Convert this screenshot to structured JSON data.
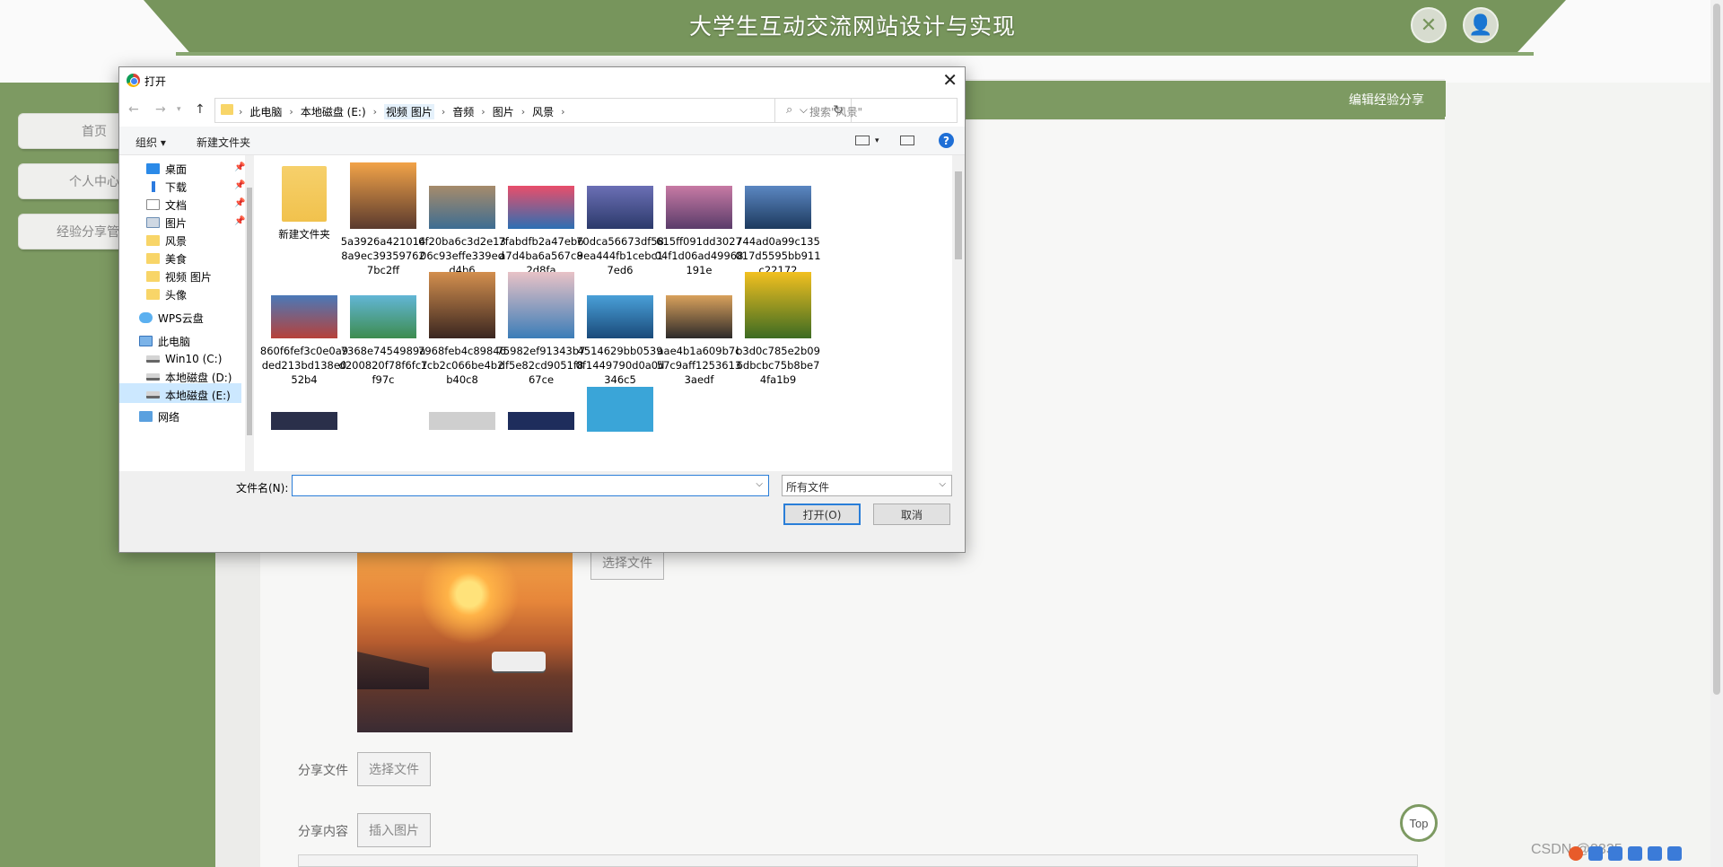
{
  "site": {
    "title": "大学生互动交流网站设计与实现",
    "green_bar_text": "编辑经验分享",
    "side_menu": [
      "首页",
      "个人中心",
      "经验分享管理"
    ],
    "choose_file_label": "选择文件",
    "share_file_label": "分享文件",
    "share_content_label": "分享内容",
    "insert_image_label": "插入图片",
    "top_button": "Top",
    "watermark": "CSDN @3335"
  },
  "dialog": {
    "title": "打开",
    "breadcrumbs": [
      "此电脑",
      "本地磁盘 (E:)",
      "视频 图片",
      "音频",
      "图片",
      "风景"
    ],
    "search_placeholder": "搜索\"风景\"",
    "organize": "组织 ▾",
    "new_folder": "新建文件夹",
    "help": "?",
    "nav": [
      {
        "label": "桌面",
        "icon": "desktop-icon",
        "pinned": true
      },
      {
        "label": "下载",
        "icon": "download-icon",
        "pinned": true
      },
      {
        "label": "文档",
        "icon": "document-icon",
        "pinned": true
      },
      {
        "label": "图片",
        "icon": "pictures-icon",
        "pinned": true
      },
      {
        "label": "风景",
        "icon": "folder-icon"
      },
      {
        "label": "美食",
        "icon": "folder-icon"
      },
      {
        "label": "视频 图片",
        "icon": "folder-icon"
      },
      {
        "label": "头像",
        "icon": "folder-icon"
      },
      {
        "label": "WPS云盘",
        "icon": "cloud-icon"
      },
      {
        "label": "此电脑",
        "icon": "computer-icon"
      },
      {
        "label": "Win10 (C:)",
        "icon": "drive-icon"
      },
      {
        "label": "本地磁盘 (D:)",
        "icon": "drive-icon"
      },
      {
        "label": "本地磁盘 (E:)",
        "icon": "drive-icon",
        "selected": true
      },
      {
        "label": "网络",
        "icon": "network-icon"
      }
    ],
    "files": [
      {
        "name": "新建文件夹",
        "type": "folder"
      },
      {
        "name": "5a3926a4210148a9ec393597627bc2ff",
        "colors": [
          "#f2a348",
          "#5a3a2e"
        ]
      },
      {
        "name": "6f20ba6c3d2e1306c93effe339edd4b6",
        "colors": [
          "#a68b6b",
          "#3d6d92"
        ]
      },
      {
        "name": "7fabdfb2a47eb6a7d4ba6a567c82d8fa",
        "colors": [
          "#e94e6a",
          "#2c6fb3"
        ]
      },
      {
        "name": "70dca56673df589ea444fb1cebc17ed6",
        "colors": [
          "#6b6fb5",
          "#2c3a6b"
        ]
      },
      {
        "name": "615ff091dd302704f1d06ad49968191e",
        "colors": [
          "#c77aa4",
          "#5a3c6a"
        ]
      },
      {
        "name": "744ad0a99c135017d5595bb911c22172",
        "colors": [
          "#5b87c2",
          "#1d3a5e"
        ]
      },
      {
        "name": "860f6fef3c0e0a9ded213bd138e052b4",
        "colors": [
          "#4a79b8",
          "#b7413a"
        ]
      },
      {
        "name": "7368e7454989ad200820f78f6fc7f97c",
        "colors": [
          "#62b6d6",
          "#3d8c4f"
        ]
      },
      {
        "name": "7968feb4c898461cb2c066be4b2b40c8",
        "colors": [
          "#d38f4e",
          "#3a2620"
        ]
      },
      {
        "name": "75982ef91343b7df5e82cd9051f867ce",
        "colors": [
          "#e8c2c6",
          "#3b7db8"
        ]
      },
      {
        "name": "4514629bb05390f1449790d0a0d346c5",
        "colors": [
          "#4aa0d8",
          "#1a4a7a"
        ]
      },
      {
        "name": "aae4b1a609b7c57c9aff12536133aedf",
        "colors": [
          "#d9a15c",
          "#2d2a2a"
        ]
      },
      {
        "name": "b3d0c785e2b096dbcbc75b8be74fa1b9",
        "colors": [
          "#f2c020",
          "#3c6b22"
        ]
      }
    ],
    "filename_label": "文件名(N):",
    "filename_value": "",
    "filetype": "所有文件",
    "open_button": "打开(O)",
    "cancel_button": "取消"
  }
}
